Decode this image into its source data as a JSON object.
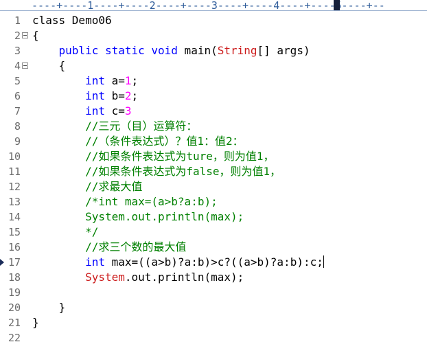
{
  "ruler": {
    "track": "----+----1----+----2----+----3----+----4----+----5----+--"
  },
  "lines": [
    {
      "n": "1",
      "fold": false,
      "marker": false,
      "tokens": [
        {
          "t": "class Demo06",
          "c": "plain"
        }
      ]
    },
    {
      "n": "2",
      "fold": true,
      "marker": false,
      "tokens": [
        {
          "t": "{",
          "c": "plain"
        }
      ]
    },
    {
      "n": "3",
      "fold": false,
      "marker": false,
      "tokens": [
        {
          "t": "    ",
          "c": "plain"
        },
        {
          "t": "public static void",
          "c": "kw"
        },
        {
          "t": " main(",
          "c": "plain"
        },
        {
          "t": "String",
          "c": "cls"
        },
        {
          "t": "[] args)",
          "c": "plain"
        }
      ]
    },
    {
      "n": "4",
      "fold": true,
      "marker": false,
      "tokens": [
        {
          "t": "    {",
          "c": "plain"
        }
      ]
    },
    {
      "n": "5",
      "fold": false,
      "marker": false,
      "tokens": [
        {
          "t": "        ",
          "c": "plain"
        },
        {
          "t": "int",
          "c": "type"
        },
        {
          "t": " a=",
          "c": "plain"
        },
        {
          "t": "1",
          "c": "num"
        },
        {
          "t": ";",
          "c": "plain"
        }
      ]
    },
    {
      "n": "6",
      "fold": false,
      "marker": false,
      "tokens": [
        {
          "t": "        ",
          "c": "plain"
        },
        {
          "t": "int",
          "c": "type"
        },
        {
          "t": " b=",
          "c": "plain"
        },
        {
          "t": "2",
          "c": "num"
        },
        {
          "t": ";",
          "c": "plain"
        }
      ]
    },
    {
      "n": "7",
      "fold": false,
      "marker": false,
      "tokens": [
        {
          "t": "        ",
          "c": "plain"
        },
        {
          "t": "int",
          "c": "type"
        },
        {
          "t": " c=",
          "c": "plain"
        },
        {
          "t": "3",
          "c": "num"
        }
      ]
    },
    {
      "n": "8",
      "fold": false,
      "marker": false,
      "tokens": [
        {
          "t": "        ",
          "c": "plain"
        },
        {
          "t": "//三元（目）运算符：",
          "c": "cm"
        }
      ]
    },
    {
      "n": "9",
      "fold": false,
      "marker": false,
      "tokens": [
        {
          "t": "        ",
          "c": "plain"
        },
        {
          "t": "//（条件表达式）？值1：值2：",
          "c": "cm"
        }
      ]
    },
    {
      "n": "10",
      "fold": false,
      "marker": false,
      "tokens": [
        {
          "t": "        ",
          "c": "plain"
        },
        {
          "t": "//如果条件表达式为ture，则为值1，",
          "c": "cm"
        }
      ]
    },
    {
      "n": "11",
      "fold": false,
      "marker": false,
      "tokens": [
        {
          "t": "        ",
          "c": "plain"
        },
        {
          "t": "//如果条件表达式为false，则为值1，",
          "c": "cm"
        }
      ]
    },
    {
      "n": "12",
      "fold": false,
      "marker": false,
      "tokens": [
        {
          "t": "        ",
          "c": "plain"
        },
        {
          "t": "//求最大值",
          "c": "cm"
        }
      ]
    },
    {
      "n": "13",
      "fold": false,
      "marker": false,
      "tokens": [
        {
          "t": "        ",
          "c": "plain"
        },
        {
          "t": "/*int max=(a>b?a:b);",
          "c": "cm"
        }
      ]
    },
    {
      "n": "14",
      "fold": false,
      "marker": false,
      "tokens": [
        {
          "t": "        ",
          "c": "plain"
        },
        {
          "t": "System.out.println(max);",
          "c": "cm"
        }
      ]
    },
    {
      "n": "15",
      "fold": false,
      "marker": false,
      "tokens": [
        {
          "t": "        ",
          "c": "plain"
        },
        {
          "t": "*/",
          "c": "cm"
        }
      ]
    },
    {
      "n": "16",
      "fold": false,
      "marker": false,
      "tokens": [
        {
          "t": "        ",
          "c": "plain"
        },
        {
          "t": "//求三个数的最大值",
          "c": "cm"
        }
      ]
    },
    {
      "n": "17",
      "fold": false,
      "marker": true,
      "caret": true,
      "tokens": [
        {
          "t": "        ",
          "c": "plain"
        },
        {
          "t": "int",
          "c": "type"
        },
        {
          "t": " max=((a>b)?a:b)>c?((a>b)?a:b):c;",
          "c": "plain"
        }
      ]
    },
    {
      "n": "18",
      "fold": false,
      "marker": false,
      "tokens": [
        {
          "t": "        ",
          "c": "plain"
        },
        {
          "t": "System",
          "c": "cls"
        },
        {
          "t": ".out.println(max);",
          "c": "plain"
        }
      ]
    },
    {
      "n": "19",
      "fold": false,
      "marker": false,
      "tokens": []
    },
    {
      "n": "20",
      "fold": false,
      "marker": false,
      "tokens": [
        {
          "t": "    }",
          "c": "plain"
        }
      ]
    },
    {
      "n": "21",
      "fold": false,
      "marker": false,
      "tokens": [
        {
          "t": "}",
          "c": "plain"
        }
      ]
    },
    {
      "n": "22",
      "fold": false,
      "marker": false,
      "tokens": []
    }
  ],
  "colors": {
    "keyword": "#0000ff",
    "class": "#cc1b1b",
    "number": "#ff00ff",
    "comment": "#008000",
    "line_number": "#6a6a6a",
    "ruler": "#2f5c9a"
  }
}
